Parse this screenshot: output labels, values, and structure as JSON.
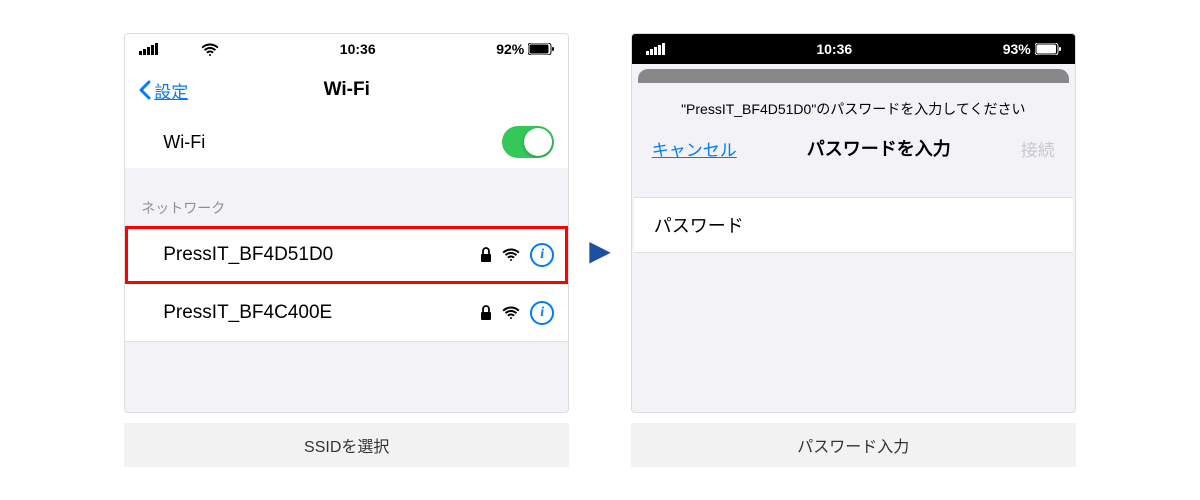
{
  "left": {
    "status": {
      "time": "10:36",
      "battery": "92%"
    },
    "nav": {
      "back": "設定",
      "title": "Wi-Fi"
    },
    "wifi_toggle_label": "Wi-Fi",
    "section_header": "ネットワーク",
    "networks": [
      {
        "name": "PressIT_BF4D51D0"
      },
      {
        "name": "PressIT_BF4C400E"
      }
    ],
    "caption": "SSIDを選択"
  },
  "right": {
    "status": {
      "time": "10:36",
      "battery": "93%"
    },
    "prompt": "\"PressIT_BF4D51D0\"のパスワードを入力してください",
    "cancel": "キャンセル",
    "title": "パスワードを入力",
    "connect": "接続",
    "password_label": "パスワード",
    "caption": "パスワード入力"
  }
}
